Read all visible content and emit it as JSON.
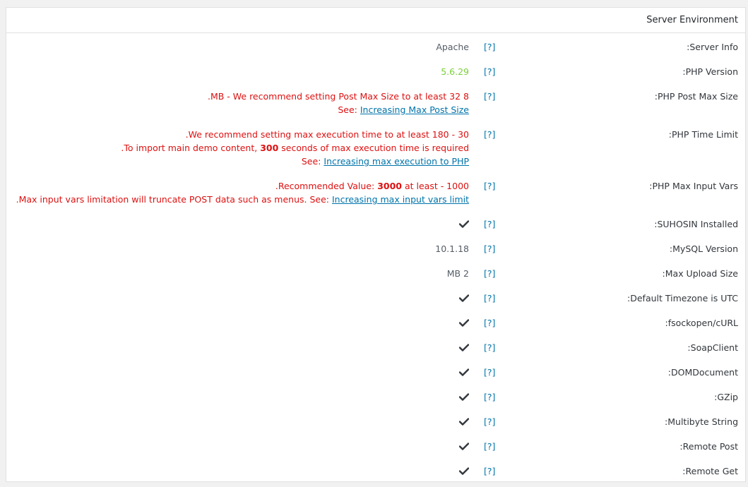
{
  "panel": {
    "title": "Server Environment"
  },
  "help_label": "[?]",
  "rows": {
    "server_info": {
      "label": ":Server Info",
      "value": "Apache"
    },
    "php_version": {
      "label": ":PHP Version",
      "value": "5.6.29",
      "status": "good"
    },
    "php_post_max_size": {
      "label": ":PHP Post Max Size",
      "line1": ".MB - We recommend setting Post Max Size to at least 32 8",
      "line2_prefix": "See: ",
      "line2_link": "Increasing Max Post Size",
      "status": "bad"
    },
    "php_time_limit": {
      "label": ":PHP Time Limit",
      "line1": ".We recommend setting max execution time to at least 180 - 30",
      "line2_prefix": ".To import main demo content, ",
      "line2_bold": "300",
      "line2_suffix": " seconds of max execution time is required",
      "line3_prefix": "See: ",
      "line3_link": "Increasing max execution to PHP",
      "status": "bad"
    },
    "php_max_input_vars": {
      "label": ":PHP Max Input Vars",
      "line1_prefix": ".Recommended Value: ",
      "line1_bold": "3000",
      "line1_suffix": " at least - 1000",
      "line2_prefix": ".Max input vars limitation will truncate POST data such as menus. See: ",
      "line2_link": "Increasing max input vars limit",
      "status": "bad"
    },
    "suhosin_installed": {
      "label": ":SUHOSIN Installed",
      "icon": "checkmark-icon"
    },
    "mysql_version": {
      "label": ":MySQL Version",
      "value": "10.1.18"
    },
    "max_upload_size": {
      "label": ":Max Upload Size",
      "value": "MB 2"
    },
    "default_timezone": {
      "label": ":Default Timezone is UTC",
      "icon": "checkmark-icon"
    },
    "fsockopen_curl": {
      "label": ":fsockopen/cURL",
      "icon": "checkmark-icon"
    },
    "soapclient": {
      "label": ":SoapClient",
      "icon": "checkmark-icon"
    },
    "domdocument": {
      "label": ":DOMDocument",
      "icon": "checkmark-icon"
    },
    "gzip": {
      "label": ":GZip",
      "icon": "checkmark-icon"
    },
    "multibyte_string": {
      "label": ":Multibyte String",
      "icon": "checkmark-icon"
    },
    "remote_post": {
      "label": ":Remote Post",
      "icon": "checkmark-icon"
    },
    "remote_get": {
      "label": ":Remote Get",
      "icon": "checkmark-icon"
    }
  },
  "colors": {
    "good": "#7ad03a",
    "bad": "#dd1111",
    "link": "#0073aa"
  }
}
